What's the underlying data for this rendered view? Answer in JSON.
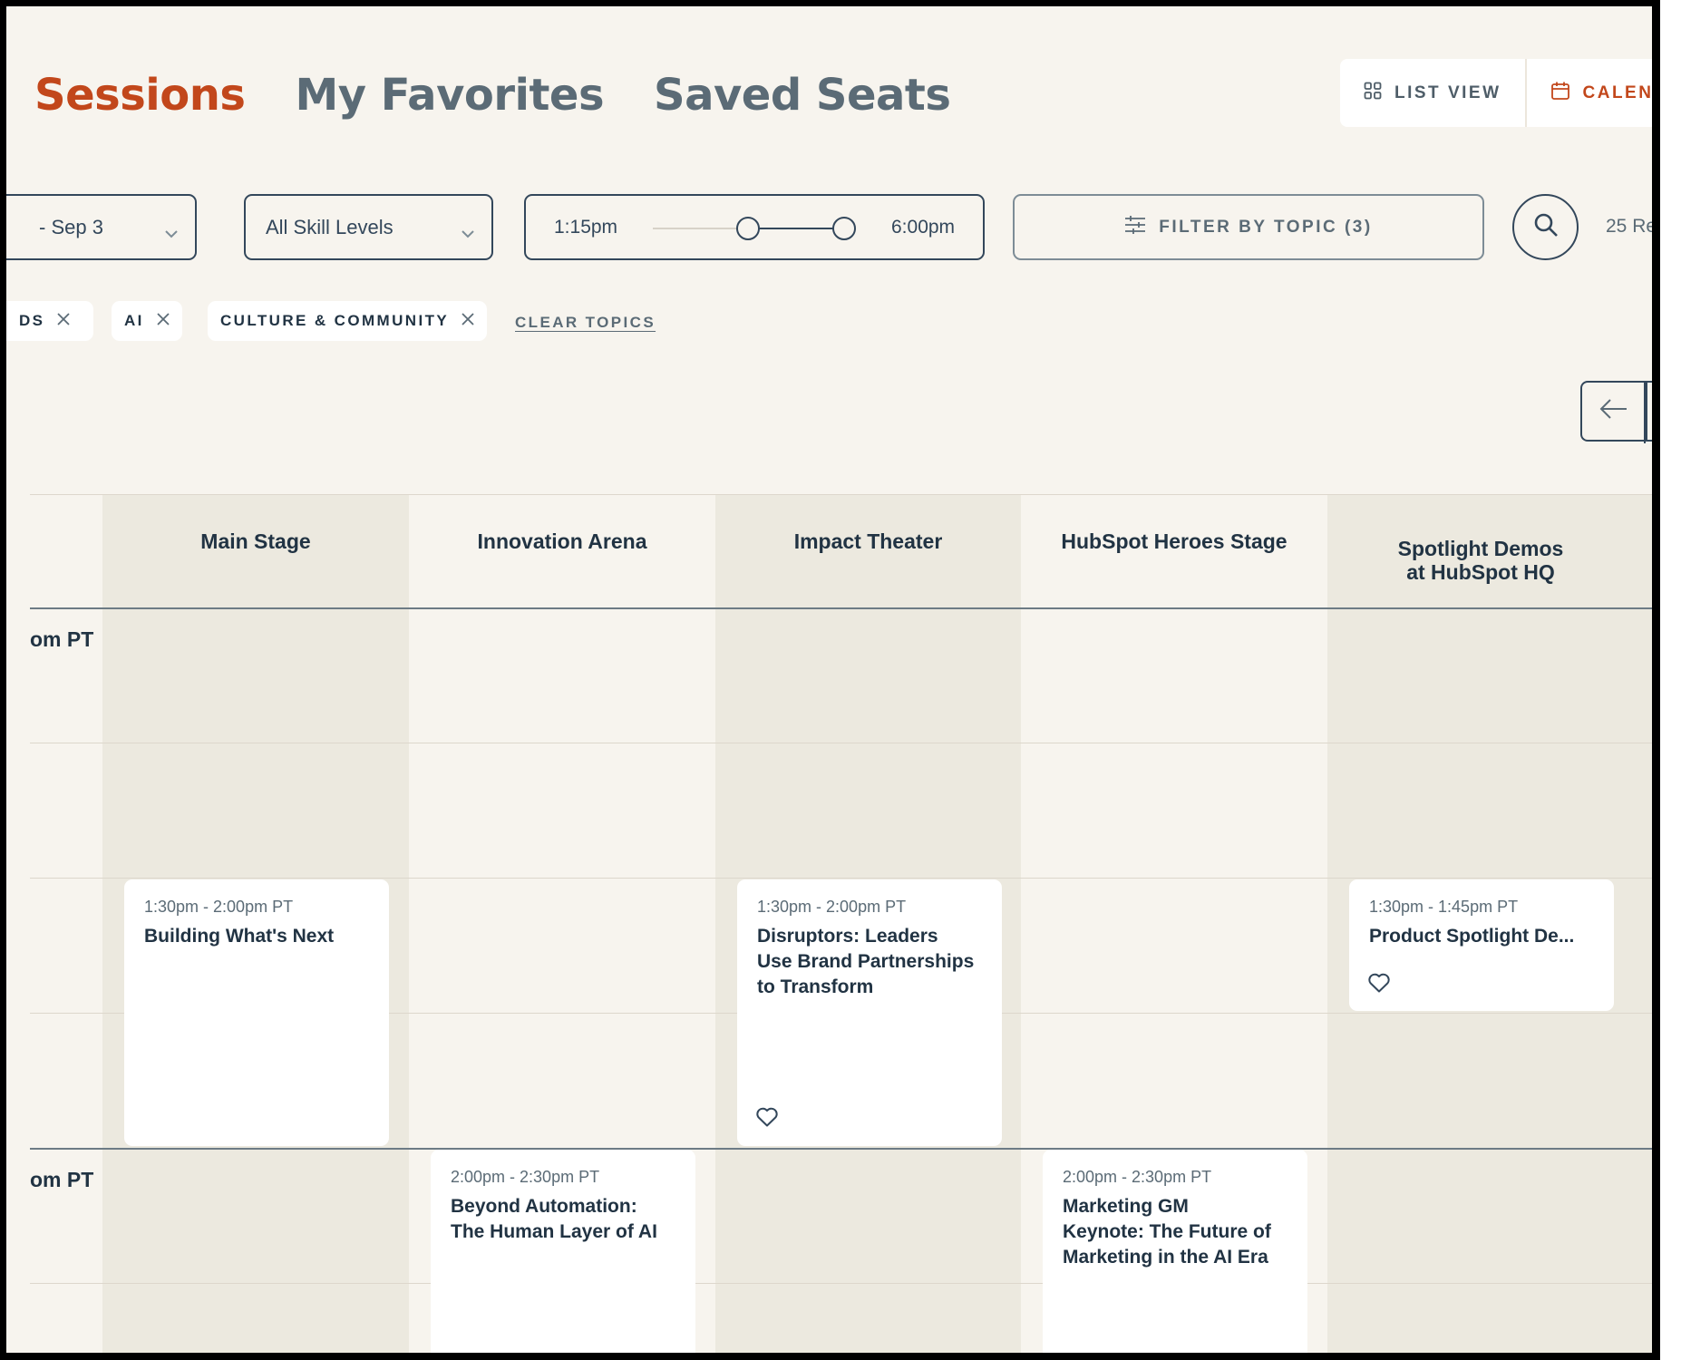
{
  "tabs": {
    "sessions": "Sessions",
    "favorites": "My Favorites",
    "saved": "Saved Seats"
  },
  "view_toggle": {
    "list": "LIST VIEW",
    "calendar": "CALEND"
  },
  "filters": {
    "date": "- Sep 3",
    "skill": "All Skill Levels",
    "time_start": "1:15pm",
    "time_end": "6:00pm",
    "topic_button": "FILTER BY TOPIC (3)",
    "results": "25 Re"
  },
  "chips": {
    "chip1": "DS",
    "chip2": "AI",
    "chip3": "CULTURE & COMMUNITY",
    "clear": "CLEAR TOPICS"
  },
  "rooms": [
    "Main Stage",
    "Innovation Arena",
    "Impact Theater",
    "HubSpot Heroes Stage",
    "Spotlight Demos at HubSpot HQ"
  ],
  "room_lines": {
    "spotlight_1": "Spotlight Demos",
    "spotlight_2": "at HubSpot HQ"
  },
  "time_slots": [
    "om PT",
    "om PT"
  ],
  "sessions": [
    {
      "time": "1:30pm - 2:00pm PT",
      "title": "Building What's Next",
      "room": "Main Stage"
    },
    {
      "time": "1:30pm - 2:00pm PT",
      "title_lines": [
        "Disruptors: Leaders",
        "Use Brand Partnerships",
        "to Transform"
      ],
      "room": "Impact Theater"
    },
    {
      "time": "1:30pm - 1:45pm PT",
      "title": "Product Spotlight De...",
      "room": "Spotlight Demos at HubSpot HQ"
    },
    {
      "time": "2:00pm - 2:30pm PT",
      "title_lines": [
        "Beyond Automation:",
        "The Human Layer of AI"
      ],
      "room": "Innovation Arena"
    },
    {
      "time": "2:00pm - 2:30pm PT",
      "title_lines": [
        "Marketing GM",
        "Keynote: The Future of",
        "Marketing in the AI Era"
      ],
      "room": "HubSpot Heroes Stage"
    }
  ],
  "colors": {
    "accent": "#c2471b",
    "background": "#f7f4ee",
    "column_shade": "#ece9df",
    "text": "#213343"
  },
  "icons": {
    "list_view": "grid-icon",
    "calendar": "calendar-icon",
    "chevron": "chevron-down-icon",
    "filter": "sliders-icon",
    "search": "search-icon",
    "close": "close-icon",
    "prev": "arrow-left-icon",
    "favorite": "heart-icon"
  }
}
